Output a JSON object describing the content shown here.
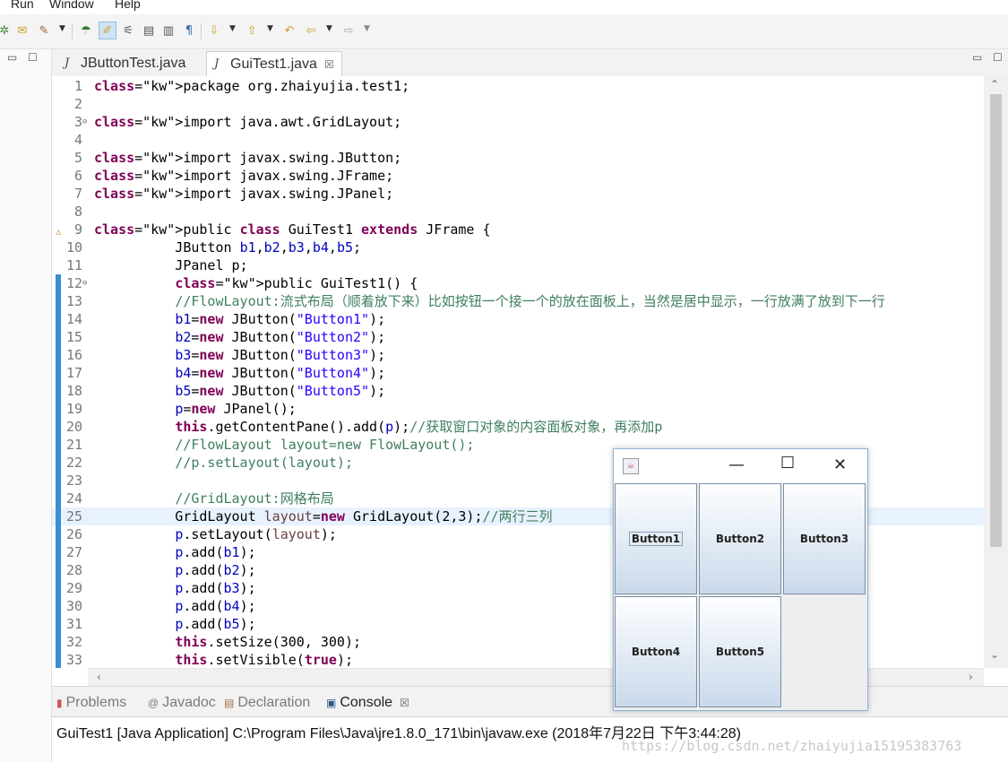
{
  "menu": {
    "items": [
      "Run",
      "Window",
      "Help"
    ]
  },
  "toolbar": {
    "icons": [
      "debug-icon",
      "open-type-icon",
      "run-last-icon",
      "dropdown",
      "new-java-icon",
      "mark-occurrences-icon",
      "toggle-block-icon",
      "show-whitespace-icon",
      "word-wrap-icon",
      "pilcrow-icon",
      "next-annotation-icon",
      "prev-annotation-icon",
      "last-edit-icon",
      "back-icon",
      "forward-icon"
    ]
  },
  "tabs": [
    {
      "label": "JButtonTest.java",
      "active": false
    },
    {
      "label": "GuiTest1.java",
      "active": true,
      "close": "☒"
    }
  ],
  "editor": {
    "lines": [
      {
        "n": "1",
        "text": "package org.zhaiyujia.test1;"
      },
      {
        "n": "2",
        "text": ""
      },
      {
        "n": "3",
        "text": "import java.awt.GridLayout;"
      },
      {
        "n": "4",
        "text": ""
      },
      {
        "n": "5",
        "text": "import javax.swing.JButton;"
      },
      {
        "n": "6",
        "text": "import javax.swing.JFrame;"
      },
      {
        "n": "7",
        "text": "import javax.swing.JPanel;"
      },
      {
        "n": "8",
        "text": ""
      },
      {
        "n": "9",
        "text": "public class GuiTest1 extends JFrame {"
      },
      {
        "n": "10",
        "text": "          JButton b1,b2,b3,b4,b5;"
      },
      {
        "n": "11",
        "text": "          JPanel p;"
      },
      {
        "n": "12",
        "text": "          public GuiTest1() {"
      },
      {
        "n": "13",
        "text": "          //FlowLayout:流式布局（顺着放下来）比如按钮一个接一个的放在面板上，当然是居中显示，一行放满了放到下一行"
      },
      {
        "n": "14",
        "text": "          b1=new JButton(\"Button1\");"
      },
      {
        "n": "15",
        "text": "          b2=new JButton(\"Button2\");"
      },
      {
        "n": "16",
        "text": "          b3=new JButton(\"Button3\");"
      },
      {
        "n": "17",
        "text": "          b4=new JButton(\"Button4\");"
      },
      {
        "n": "18",
        "text": "          b5=new JButton(\"Button5\");"
      },
      {
        "n": "19",
        "text": "          p=new JPanel();"
      },
      {
        "n": "20",
        "text": "          this.getContentPane().add(p);//获取窗口对象的内容面板对象，再添加p"
      },
      {
        "n": "21",
        "text": "          //FlowLayout layout=new FlowLayout();"
      },
      {
        "n": "22",
        "text": "          //p.setLayout(layout);"
      },
      {
        "n": "23",
        "text": ""
      },
      {
        "n": "24",
        "text": "          //GridLayout:网格布局"
      },
      {
        "n": "25",
        "text": "          GridLayout layout=new GridLayout(2,3);//两行三列"
      },
      {
        "n": "26",
        "text": "          p.setLayout(layout);"
      },
      {
        "n": "27",
        "text": "          p.add(b1);"
      },
      {
        "n": "28",
        "text": "          p.add(b2);"
      },
      {
        "n": "29",
        "text": "          p.add(b3);"
      },
      {
        "n": "30",
        "text": "          p.add(b4);"
      },
      {
        "n": "31",
        "text": "          p.add(b5);"
      },
      {
        "n": "32",
        "text": "          this.setSize(300, 300);"
      },
      {
        "n": "33",
        "text": "          this.setVisible(true);"
      }
    ]
  },
  "bottom": {
    "tabs": [
      {
        "label": "Problems",
        "active": false
      },
      {
        "label": "Javadoc",
        "active": false
      },
      {
        "label": "Declaration",
        "active": false
      },
      {
        "label": "Console",
        "active": true,
        "close": "☒"
      }
    ],
    "console_header": "GuiTest1 [Java Application] C:\\Program Files\\Java\\jre1.8.0_171\\bin\\javaw.exe (2018年7月22日 下午3:44:28)",
    "watermark": "https://blog.csdn.net/zhaiyujia15195383763"
  },
  "swing_window": {
    "buttons": [
      "Button1",
      "Button2",
      "Button3",
      "Button4",
      "Button5"
    ]
  }
}
